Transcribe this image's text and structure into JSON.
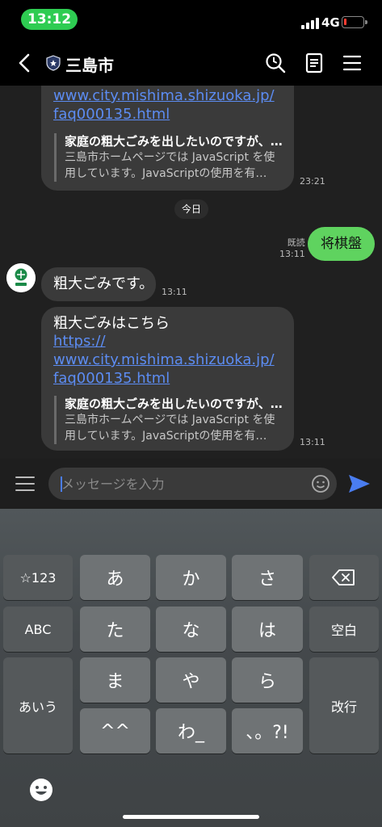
{
  "status": {
    "time": "13:12",
    "network": "4G",
    "battery_level": 0.15
  },
  "header": {
    "title": "三島市"
  },
  "messages": {
    "first": {
      "link_lines": [
        "www.city.mishima.shizuoka.jp/",
        "faq000135.html"
      ],
      "preview_title": "家庭の粗大ごみを出したいのですが、…",
      "preview_desc": [
        "三島市ホームページでは JavaScript を使",
        "用しています。JavaScriptの使用を有…"
      ],
      "time": "23:21"
    },
    "date_divider": "今日",
    "sent": {
      "text": "将棋盤",
      "read_label": "既読",
      "time": "13:11"
    },
    "reply_short": {
      "text": "粗大ごみです。",
      "time": "13:11"
    },
    "reply_link": {
      "intro": "粗大ごみはこちら",
      "link_lines": [
        "https://",
        "www.city.mishima.shizuoka.jp/",
        "faq000135.html"
      ],
      "preview_title": "家庭の粗大ごみを出したいのですが、…",
      "preview_desc": [
        "三島市ホームページでは JavaScript を使",
        "用しています。JavaScriptの使用を有…"
      ],
      "time": "13:11"
    }
  },
  "input": {
    "placeholder": "メッセージを入力",
    "value": ""
  },
  "keyboard": {
    "row1": [
      "☆123",
      "あ",
      "か",
      "さ"
    ],
    "row2": [
      "ABC",
      "た",
      "な",
      "は",
      "空白"
    ],
    "row3": [
      "ま",
      "や",
      "ら"
    ],
    "row4": [
      "^^",
      "わ_",
      "、。?!"
    ],
    "left_bottom": "あいう",
    "return": "改行"
  },
  "colors": {
    "accent_green": "#5fd35f",
    "link_blue": "#5c8cf2",
    "send_blue": "#4a7df0",
    "time_pill_green": "#2ecc52"
  }
}
